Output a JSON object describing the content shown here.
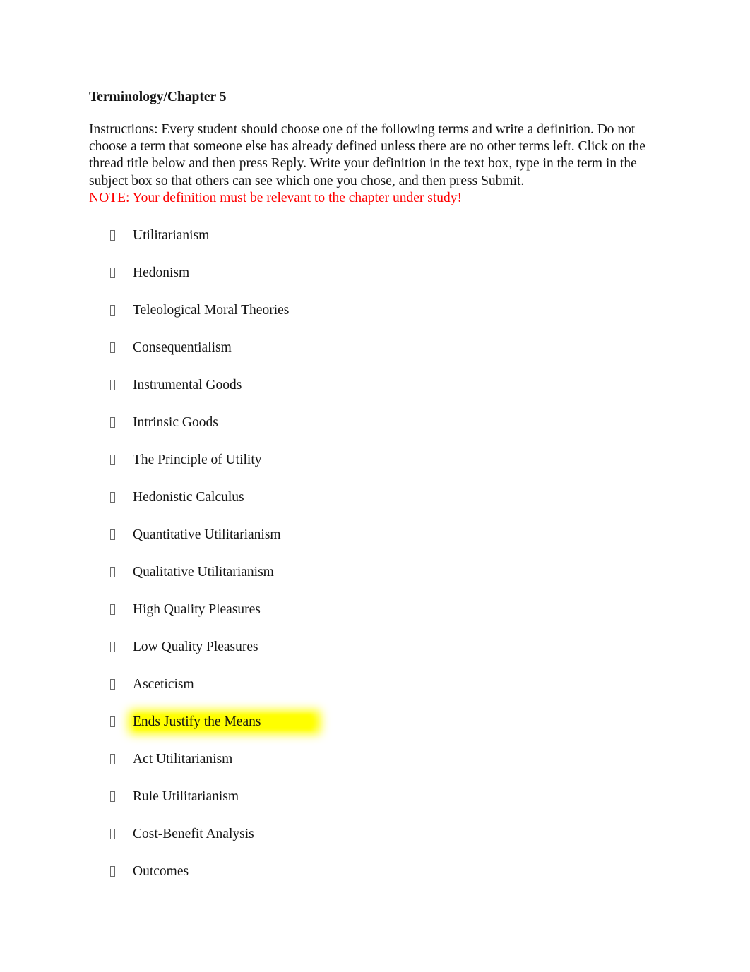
{
  "document": {
    "title": "Terminology/Chapter 5",
    "instructions": {
      "lines": [
        "Instructions: Every student should choose one of the following terms and write a definition. Do",
        "not choose a term that someone else has already defined unless there are no other terms left.",
        "Click on the thread title below and then press Reply. Write your definition in the text box, type",
        "in the term in the subject box so that others can see which one you chose, and then press Submit."
      ],
      "full_text": "Instructions: Every student should choose one of the following terms and write a definition. Do not choose a term that someone else has already defined unless there are no other terms left. Click on the thread title below and then press Reply. Write your definition in the text box, type in the term in the subject box so that others can see which one you chose, and then press Submit.",
      "note": "NOTE: Your definition must be relevant to the chapter under study!",
      "note_color": "#ff0000"
    },
    "bullet_glyph_name": "missing-glyph-box-bullet",
    "highlight_color": "#ffff00",
    "terms": [
      {
        "label": "Utilitarianism",
        "highlighted": false
      },
      {
        "label": "Hedonism",
        "highlighted": false
      },
      {
        "label": "Teleological Moral Theories",
        "highlighted": false
      },
      {
        "label": "Consequentialism",
        "highlighted": false
      },
      {
        "label": "Instrumental Goods",
        "highlighted": false
      },
      {
        "label": "Intrinsic Goods",
        "highlighted": false
      },
      {
        "label": "The Principle of Utility",
        "highlighted": false
      },
      {
        "label": "Hedonistic Calculus",
        "highlighted": false
      },
      {
        "label": "Quantitative Utilitarianism",
        "highlighted": false
      },
      {
        "label": "Qualitative Utilitarianism",
        "highlighted": false
      },
      {
        "label": "High Quality Pleasures",
        "highlighted": false
      },
      {
        "label": "Low Quality Pleasures",
        "highlighted": false
      },
      {
        "label": "Asceticism",
        "highlighted": false
      },
      {
        "label": "Ends Justify the Means",
        "highlighted": true
      },
      {
        "label": "Act Utilitarianism",
        "highlighted": false
      },
      {
        "label": "Rule Utilitarianism",
        "highlighted": false
      },
      {
        "label": "Cost-Benefit Analysis",
        "highlighted": false
      },
      {
        "label": "Outcomes",
        "highlighted": false
      }
    ]
  }
}
